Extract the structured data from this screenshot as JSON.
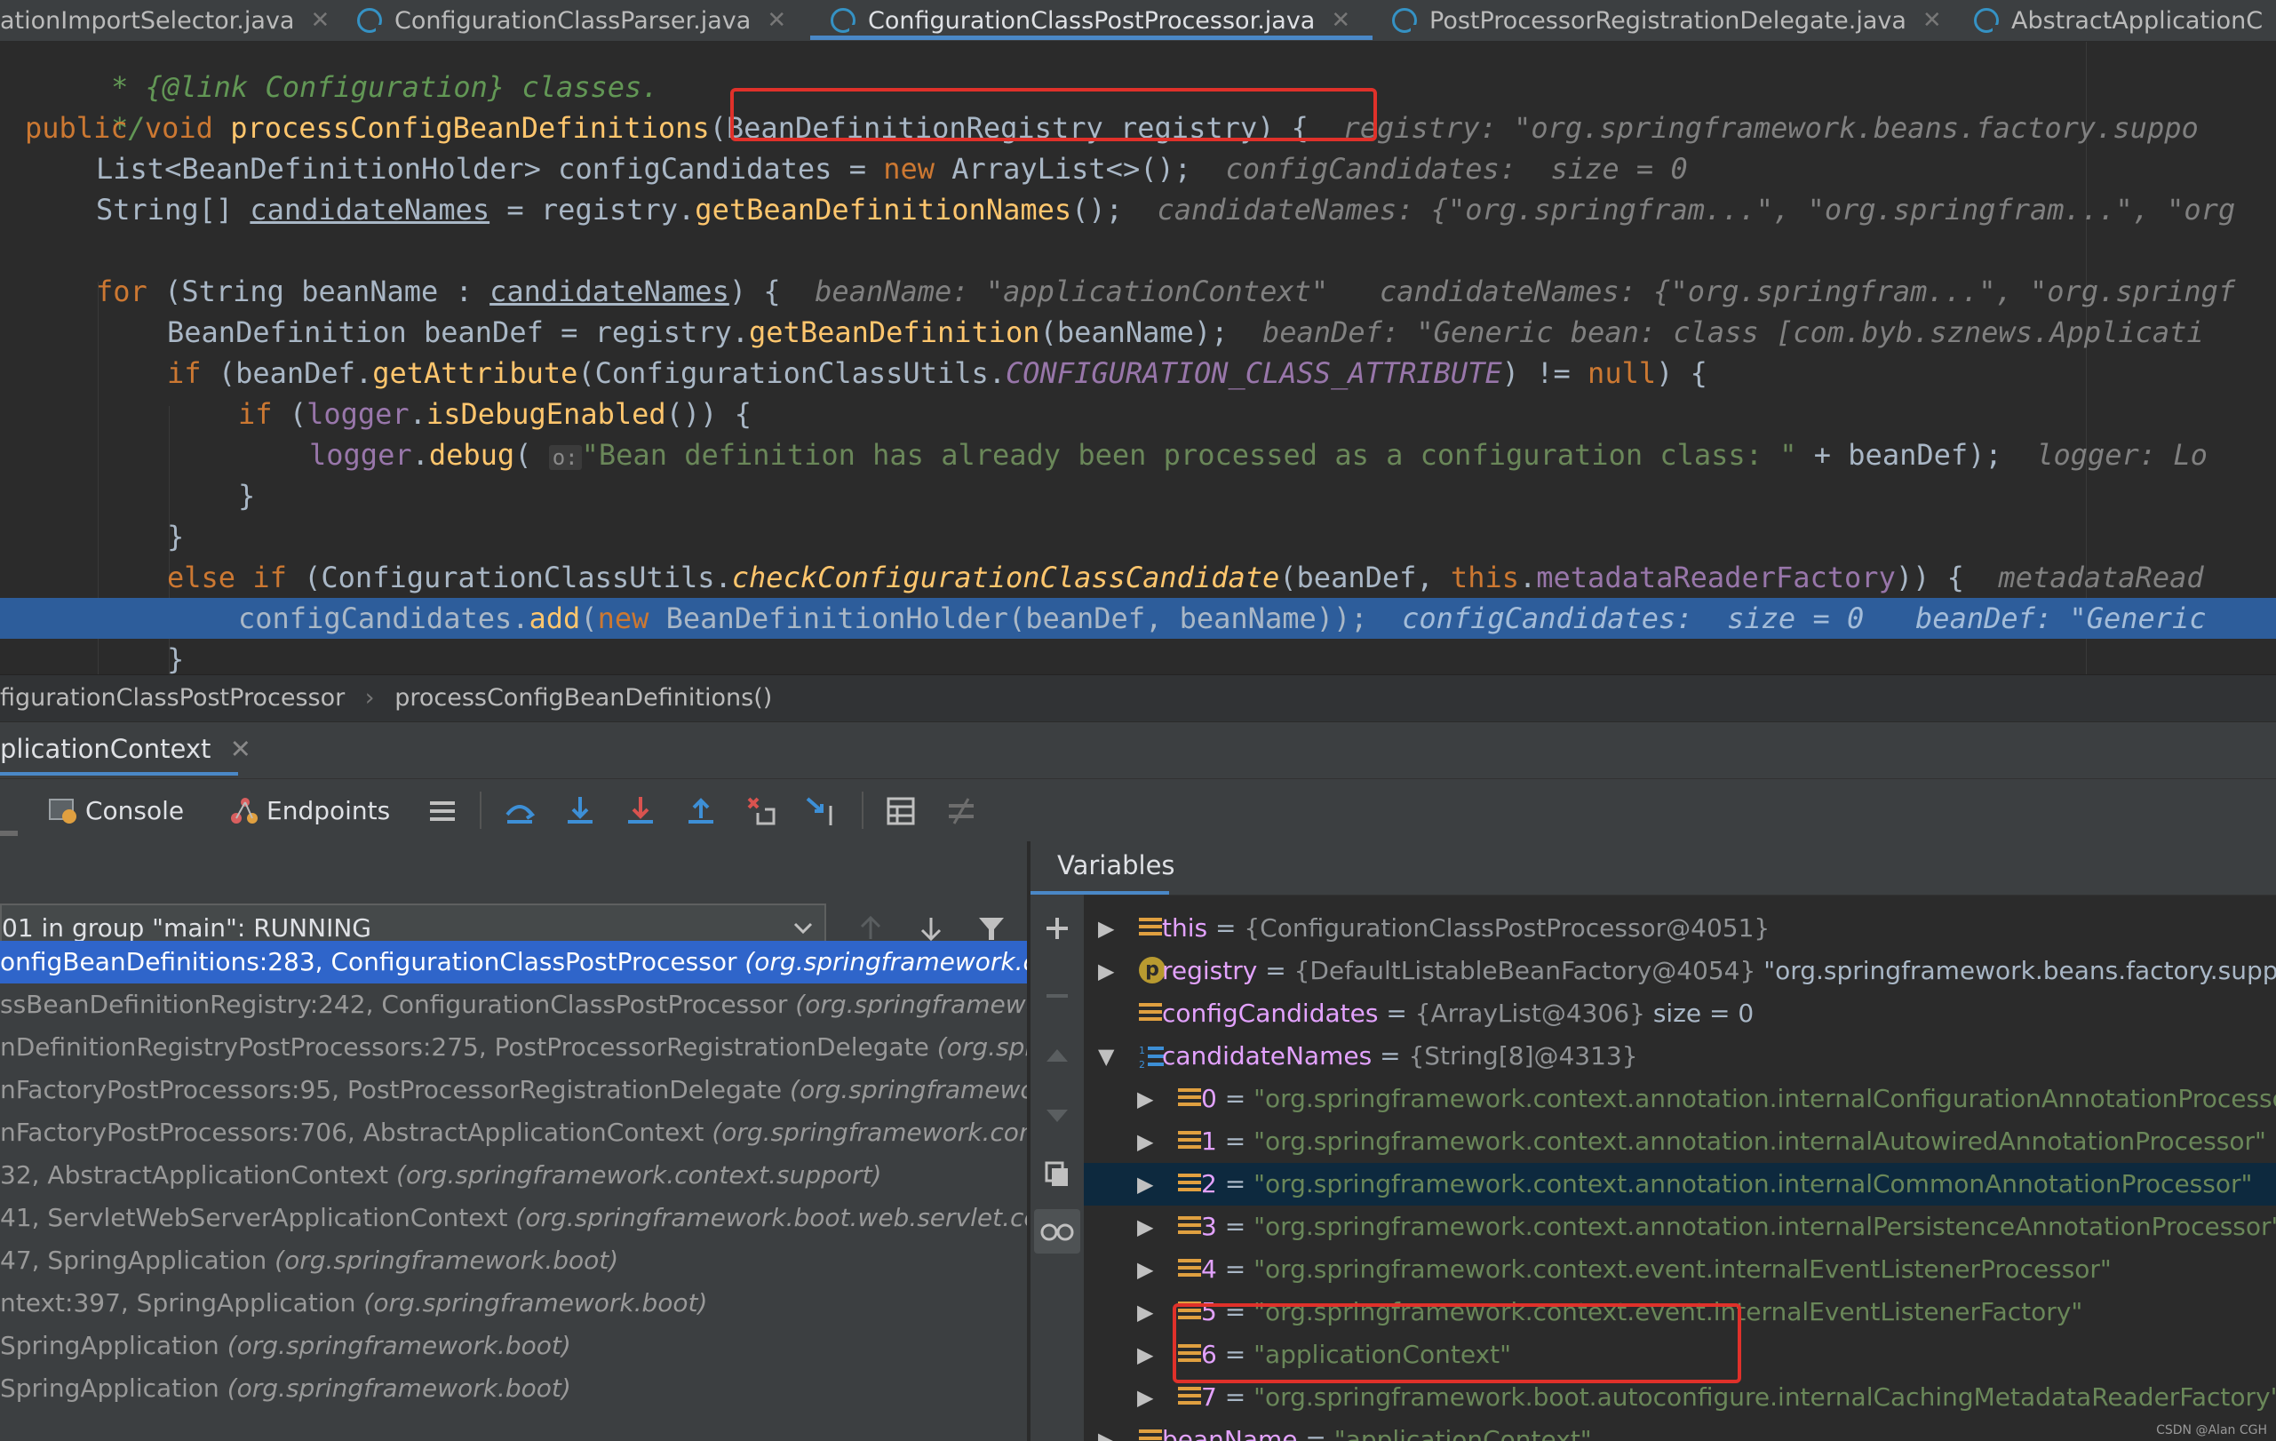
{
  "tabs": [
    {
      "label": "ationImportSelector.java",
      "active": false
    },
    {
      "label": "ConfigurationClassParser.java",
      "active": false
    },
    {
      "label": "ConfigurationClassPostProcessor.java",
      "active": true
    },
    {
      "label": "PostProcessorRegistrationDelegate.java",
      "active": false
    },
    {
      "label": "AbstractApplicationC",
      "active": false
    }
  ],
  "editor": {
    "comment_line_1": "* {@link Configuration} classes.",
    "comment_line_2": "*/",
    "l3_mod": "public void ",
    "l3_fn": "processConfigBeanDefinitions",
    "l3_params": "(BeanDefinitionRegistry registry) {",
    "l3_hint": "registry: \"org.springframework.beans.factory.suppo",
    "l4_type": "List<BeanDefinitionHolder> configCandidates = ",
    "l4_new": "new",
    "l4_rest": " ArrayList<>();",
    "l4_hint": "configCandidates:  size = 0",
    "l5_type": "String[] ",
    "l5_var": "candidateNames",
    "l5_eq": " = registry.",
    "l5_fn": "getBeanDefinitionNames",
    "l5_end": "();",
    "l5_hint": "candidateNames: {\"org.springfram...\", \"org.springfram...\", \"org",
    "l7_kw": "for",
    "l7_a": " (String beanName : ",
    "l7_var": "candidateNames",
    "l7_b": ") {",
    "l7_hint": "beanName: \"applicationContext\"   candidateNames: {\"org.springfram...\", \"org.springf",
    "l8_a": "BeanDefinition beanDef = registry.",
    "l8_fn": "getBeanDefinition",
    "l8_b": "(beanName);",
    "l8_hint": "beanDef: \"Generic bean: class [com.byb.sznews.Applicati",
    "l9_kw": "if",
    "l9_a": " (beanDef.",
    "l9_fn": "getAttribute",
    "l9_b": "(ConfigurationClassUtils.",
    "l9_const": "CONFIGURATION_CLASS_ATTRIBUTE",
    "l9_c": ") != ",
    "l9_null": "null",
    "l9_d": ") {",
    "l10_kw": "if",
    "l10_a": " (",
    "l10_fld": "logger",
    "l10_b": ".",
    "l10_fn": "isDebugEnabled",
    "l10_c": "()) {",
    "l11_fld": "logger",
    "l11_a": ".",
    "l11_fn": "debug",
    "l11_b": "( ",
    "l11_pill": "o:",
    "l11_str": "\"Bean definition has already been processed as a configuration class: \"",
    "l11_c": " + beanDef);",
    "l11_hint": "logger: Lo",
    "brace_close": "}",
    "l14_kw": "else if",
    "l14_a": " (ConfigurationClassUtils.",
    "l14_fn": "checkConfigurationClassCandidate",
    "l14_b": "(beanDef, ",
    "l14_this": "this",
    "l14_c": ".",
    "l14_fld": "metadataReaderFactory",
    "l14_d": ")) {",
    "l14_hint": "metadataRead",
    "l15_a": "configCandidates.",
    "l15_fn": "add",
    "l15_b": "(",
    "l15_new": "new",
    "l15_c": " BeanDefinitionHolder(beanDef, beanName));",
    "l15_hint": "configCandidates:  size = 0   beanDef: \"Generic"
  },
  "breadcrumb": {
    "class": "figurationClassPostProcessor",
    "sep": "›",
    "method": "processConfigBeanDefinitions()"
  },
  "debug": {
    "session_tab": "plicationContext",
    "console_label": "Console",
    "endpoints_label": "Endpoints",
    "thread": "01 in group \"main\": RUNNING",
    "variables_label": "Variables"
  },
  "frames": [
    {
      "text": "onfigBeanDefinitions:283, ConfigurationClassPostProcessor ",
      "pkg": "(org.springframework.co",
      "selected": true
    },
    {
      "text": "ssBeanDefinitionRegistry:242, ConfigurationClassPostProcessor ",
      "pkg": "(org.springframewo",
      "selected": false
    },
    {
      "text": "nDefinitionRegistryPostProcessors:275, PostProcessorRegistrationDelegate ",
      "pkg": "(org.spri",
      "selected": false
    },
    {
      "text": "nFactoryPostProcessors:95, PostProcessorRegistrationDelegate ",
      "pkg": "(org.springframewor",
      "selected": false
    },
    {
      "text": "nFactoryPostProcessors:706, AbstractApplicationContext ",
      "pkg": "(org.springframework.con",
      "selected": false
    },
    {
      "text": "32, AbstractApplicationContext ",
      "pkg": "(org.springframework.context.support)",
      "selected": false
    },
    {
      "text": "41, ServletWebServerApplicationContext ",
      "pkg": "(org.springframework.boot.web.servlet.cont",
      "selected": false
    },
    {
      "text": "47, SpringApplication ",
      "pkg": "(org.springframework.boot)",
      "selected": false
    },
    {
      "text": "ntext:397, SpringApplication ",
      "pkg": "(org.springframework.boot)",
      "selected": false
    },
    {
      "text": "SpringApplication ",
      "pkg": "(org.springframework.boot)",
      "selected": false
    },
    {
      "text": "SpringApplication ",
      "pkg": "(org.springframework.boot)",
      "selected": false
    }
  ],
  "variables": [
    {
      "name": "this",
      "type": "{ConfigurationClassPostProcessor@4051}",
      "value": "",
      "str": "",
      "arrow": "▶",
      "indent": 0,
      "icon": "bars",
      "selected": false
    },
    {
      "name": "registry",
      "type": "{DefaultListableBeanFactory@4054}",
      "value": " \"org.springframework.beans.factory.support",
      "str": "",
      "arrow": "▶",
      "indent": 0,
      "icon": "p",
      "selected": false
    },
    {
      "name": "configCandidates",
      "type": "{ArrayList@4306}",
      "value": "  size = 0",
      "str": "",
      "arrow": "",
      "indent": 0,
      "icon": "bars",
      "selected": false
    },
    {
      "name": "candidateNames",
      "type": "{String[8]@4313}",
      "value": "",
      "str": "",
      "arrow": "▼",
      "indent": 0,
      "icon": "array",
      "selected": false
    },
    {
      "name": "0",
      "type": "",
      "value": "",
      "str": "\"org.springframework.context.annotation.internalConfigurationAnnotationProcesso",
      "arrow": "▶",
      "indent": 1,
      "icon": "bars",
      "selected": false
    },
    {
      "name": "1",
      "type": "",
      "value": "",
      "str": "\"org.springframework.context.annotation.internalAutowiredAnnotationProcessor\"",
      "arrow": "▶",
      "indent": 1,
      "icon": "bars",
      "selected": false
    },
    {
      "name": "2",
      "type": "",
      "value": "",
      "str": "\"org.springframework.context.annotation.internalCommonAnnotationProcessor\"",
      "arrow": "▶",
      "indent": 1,
      "icon": "bars",
      "selected": true
    },
    {
      "name": "3",
      "type": "",
      "value": "",
      "str": "\"org.springframework.context.annotation.internalPersistenceAnnotationProcessor\"",
      "arrow": "▶",
      "indent": 1,
      "icon": "bars",
      "selected": false
    },
    {
      "name": "4",
      "type": "",
      "value": "",
      "str": "\"org.springframework.context.event.internalEventListenerProcessor\"",
      "arrow": "▶",
      "indent": 1,
      "icon": "bars",
      "selected": false
    },
    {
      "name": "5",
      "type": "",
      "value": "",
      "str": "\"org.springframework.context.event.internalEventListenerFactory\"",
      "arrow": "▶",
      "indent": 1,
      "icon": "bars",
      "selected": false
    },
    {
      "name": "6",
      "type": "",
      "value": "",
      "str": "\"applicationContext\"",
      "arrow": "▶",
      "indent": 1,
      "icon": "bars",
      "selected": false
    },
    {
      "name": "7",
      "type": "",
      "value": "",
      "str": "\"org.springframework.boot.autoconfigure.internalCachingMetadataReaderFactory\"",
      "arrow": "▶",
      "indent": 1,
      "icon": "bars",
      "selected": false
    },
    {
      "name": "beanName",
      "type": "",
      "value": "",
      "str": "\"applicationContext\"",
      "arrow": "▶",
      "indent": 0,
      "icon": "bars",
      "selected": false
    }
  ],
  "watermark": "CSDN @Alan CGH",
  "colors": {
    "accent": "#4a88c7",
    "highlight_box": "#e0312a",
    "selected_frame": "#2f65ca",
    "exec_line": "#2d5d9b"
  }
}
